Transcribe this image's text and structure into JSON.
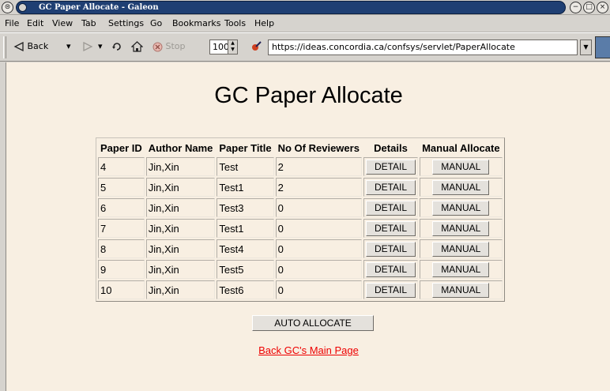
{
  "window": {
    "title": "GC Paper Allocate - Galeon"
  },
  "menubar": {
    "items": [
      "File",
      "Edit",
      "View",
      "Tab",
      "Settings",
      "Go",
      "Bookmarks",
      "Tools",
      "Help"
    ]
  },
  "toolbar": {
    "back_label": "Back",
    "stop_label": "Stop",
    "zoom_value": "100",
    "url": "https://ideas.concordia.ca/confsys/servlet/PaperAllocate"
  },
  "page": {
    "title": "GC Paper Allocate",
    "table": {
      "headers": [
        "Paper ID",
        "Author Name",
        "Paper Title",
        "No Of Reviewers",
        "Details",
        "Manual Allocate"
      ],
      "rows": [
        {
          "id": "4",
          "author": "Jin,Xin",
          "title": "Test",
          "reviewers": "2"
        },
        {
          "id": "5",
          "author": "Jin,Xin",
          "title": "Test1",
          "reviewers": "2"
        },
        {
          "id": "6",
          "author": "Jin,Xin",
          "title": "Test3",
          "reviewers": "0"
        },
        {
          "id": "7",
          "author": "Jin,Xin",
          "title": "Test1",
          "reviewers": "0"
        },
        {
          "id": "8",
          "author": "Jin,Xin",
          "title": "Test4",
          "reviewers": "0"
        },
        {
          "id": "9",
          "author": "Jin,Xin",
          "title": "Test5",
          "reviewers": "0"
        },
        {
          "id": "10",
          "author": "Jin,Xin",
          "title": "Test6",
          "reviewers": "0"
        }
      ],
      "detail_button_label": "DETAIL",
      "manual_button_label": "MANUAL"
    },
    "auto_allocate_label": "AUTO ALLOCATE",
    "back_link_label": "Back GC's Main Page"
  },
  "colors": {
    "page_background": "#f8efe2",
    "link": "#ee0000",
    "title_bar": "#1f3f73"
  }
}
